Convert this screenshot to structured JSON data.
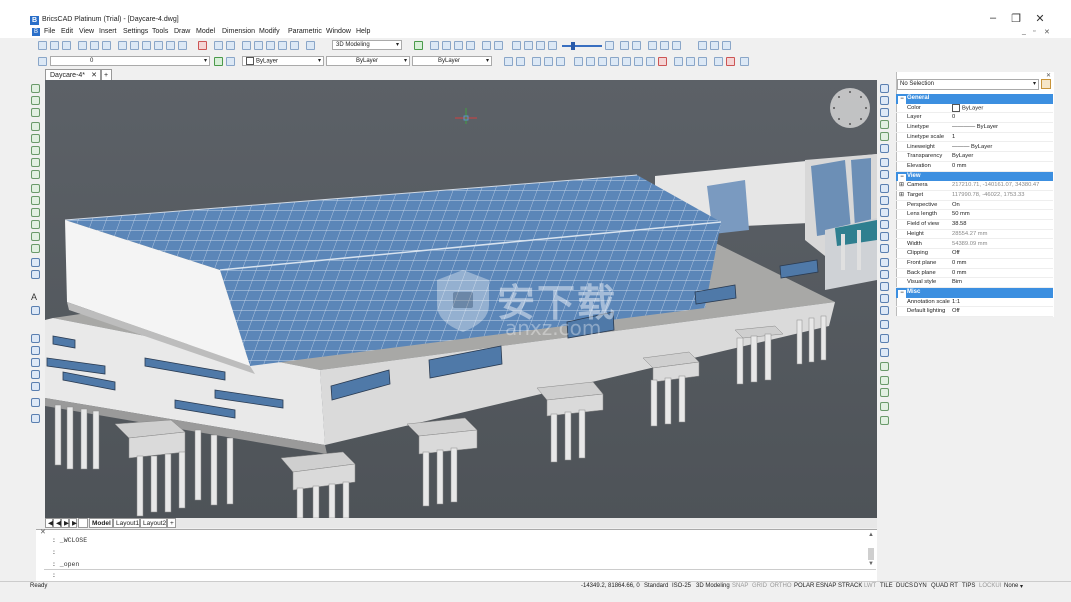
{
  "window": {
    "title": "BricsCAD Platinum (Trial) - [Daycare-4.dwg]",
    "minimize": "–",
    "maximize": "❐",
    "close": "✕"
  },
  "menu": {
    "items": [
      "File",
      "Edit",
      "View",
      "Insert",
      "Settings",
      "Tools",
      "Draw",
      "Model",
      "Dimension",
      "Modify",
      "Parametric",
      "Window",
      "Help"
    ],
    "mdi": [
      "_",
      "▫",
      "✕"
    ]
  },
  "toolbar": {
    "workspace": "3D Modeling",
    "layer": "0",
    "color": "ByLayer",
    "linetype": "ByLayer",
    "lineweight": "ByLayer"
  },
  "doc_tabs": {
    "active": "Daycare-4*",
    "close": "✕",
    "add": "+"
  },
  "layout_tabs": {
    "nav": [
      "◀",
      "◀",
      "▶",
      "▶"
    ],
    "tabs": [
      "Model",
      "Layout1",
      "Layout2"
    ],
    "add": "+"
  },
  "command": {
    "lines": [
      ": _WCLOSE",
      ":",
      ": _open"
    ],
    "prompt": ":"
  },
  "status": {
    "ready": "Ready",
    "coords": "-14349.2, 81864.66, 0",
    "items": [
      {
        "label": "Standard",
        "on": true
      },
      {
        "label": "ISO-25",
        "on": true
      },
      {
        "label": "3D Modeling",
        "on": true
      },
      {
        "label": "SNAP",
        "on": false
      },
      {
        "label": "GRID",
        "on": false
      },
      {
        "label": "ORTHO",
        "on": false
      },
      {
        "label": "POLAR",
        "on": true
      },
      {
        "label": "ESNAP",
        "on": true
      },
      {
        "label": "STRACK",
        "on": true
      },
      {
        "label": "LWT",
        "on": false
      },
      {
        "label": "TILE",
        "on": true
      },
      {
        "label": "DUCS",
        "on": true
      },
      {
        "label": "DYN",
        "on": true
      },
      {
        "label": "QUAD",
        "on": true
      },
      {
        "label": "RT",
        "on": true
      },
      {
        "label": "TIPS",
        "on": true
      },
      {
        "label": "LOCKUI",
        "on": false
      },
      {
        "label": "None",
        "on": true
      }
    ]
  },
  "properties": {
    "selection": "No Selection",
    "categories": [
      {
        "name": "General",
        "rows": [
          {
            "key": "Color",
            "value": "ByLayer"
          },
          {
            "key": "Layer",
            "value": "0"
          },
          {
            "key": "Linetype",
            "value": "———— ByLayer"
          },
          {
            "key": "Linetype scale",
            "value": "1"
          },
          {
            "key": "Lineweight",
            "value": "——— ByLayer"
          },
          {
            "key": "Transparency",
            "value": "ByLayer"
          },
          {
            "key": "Elevation",
            "value": "0 mm"
          }
        ]
      },
      {
        "name": "View",
        "rows": [
          {
            "key": "Camera",
            "value": "217210.71, -140161.07, 34380.47",
            "expand": true,
            "dim": true
          },
          {
            "key": "Target",
            "value": "117990.78, -46022, 1753.33",
            "expand": true,
            "dim": true
          },
          {
            "key": "Perspective",
            "value": "On"
          },
          {
            "key": "Lens length",
            "value": "50 mm"
          },
          {
            "key": "Field of view",
            "value": "38.58"
          },
          {
            "key": "Height",
            "value": "28554.27 mm",
            "dim": true
          },
          {
            "key": "Width",
            "value": "54389.09 mm",
            "dim": true
          },
          {
            "key": "Clipping",
            "value": "Off"
          },
          {
            "key": "Front plane",
            "value": "0 mm"
          },
          {
            "key": "Back plane",
            "value": "0 mm"
          },
          {
            "key": "Visual style",
            "value": "Bim"
          }
        ]
      },
      {
        "name": "Misc",
        "rows": [
          {
            "key": "Annotation scale",
            "value": "1:1"
          },
          {
            "key": "Default lighting",
            "value": "Off"
          }
        ]
      }
    ]
  },
  "watermark": {
    "text": "安下载",
    "sub": "anxz.com"
  },
  "colors": {
    "viewport_bg": "#575c62",
    "accent": "#3c8fe0",
    "glass": "#5b86b8"
  }
}
